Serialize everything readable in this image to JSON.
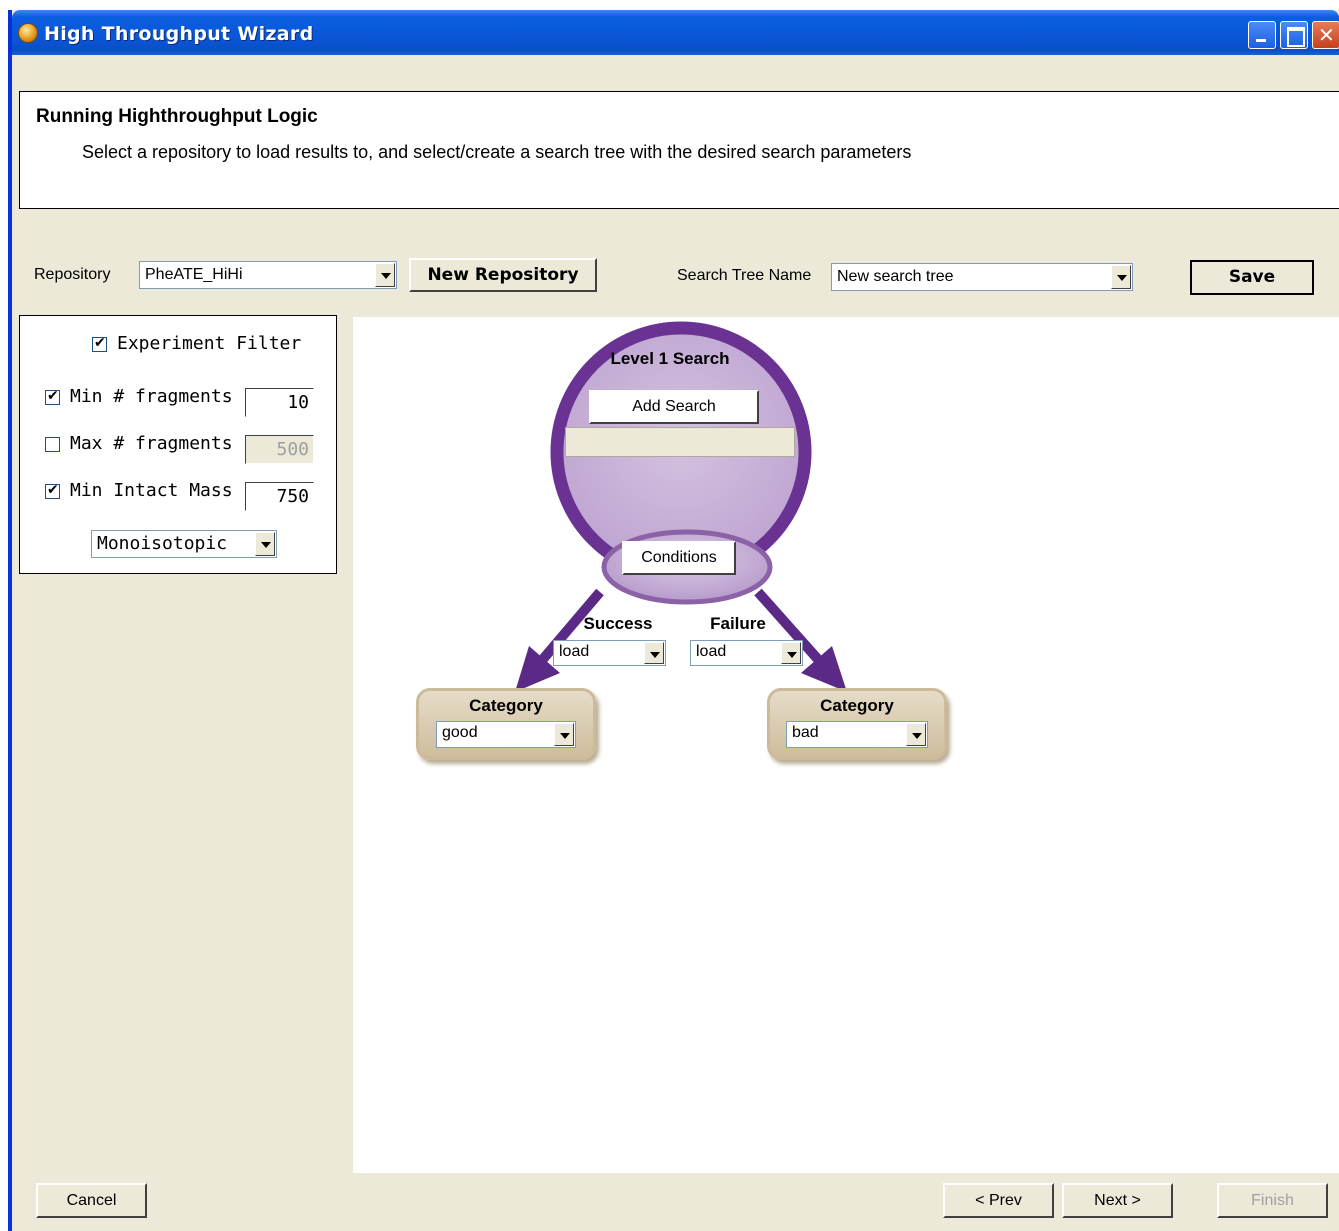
{
  "window": {
    "title": "High Throughput Wizard"
  },
  "header": {
    "title": "Running Highthroughput Logic",
    "subtitle": "Select a repository to load results to, and select/create a search tree with the desired search parameters"
  },
  "toolbar": {
    "repository_label": "Repository",
    "repository_value": "PheATE_HiHi",
    "new_repository_label": "New Repository",
    "search_tree_label": "Search Tree Name",
    "search_tree_value": "New search tree",
    "save_label": "Save"
  },
  "filter": {
    "experiment_filter_label": "Experiment Filter",
    "experiment_filter_checked": true,
    "min_fragments": {
      "label": "Min # fragments",
      "checked": true,
      "value": "10"
    },
    "max_fragments": {
      "label": "Max # fragments",
      "checked": false,
      "value": "500"
    },
    "min_intact_mass": {
      "label": "Min Intact Mass",
      "checked": true,
      "value": "750"
    },
    "mass_type": "Monoisotopic"
  },
  "tree": {
    "level_title": "Level 1 Search",
    "add_search_label": "Add Search",
    "conditions_label": "Conditions",
    "success_label": "Success",
    "success_action": "load",
    "failure_label": "Failure",
    "failure_action": "load",
    "left_category": {
      "label": "Category",
      "value": "good"
    },
    "right_category": {
      "label": "Category",
      "value": "bad"
    },
    "colors": {
      "circle_fill": "#c7b0d6",
      "circle_border": "#6a3393",
      "arrow": "#5b2a86"
    }
  },
  "footer": {
    "cancel_label": "Cancel",
    "prev_label": "< Prev",
    "next_label": "Next >",
    "finish_label": "Finish"
  }
}
